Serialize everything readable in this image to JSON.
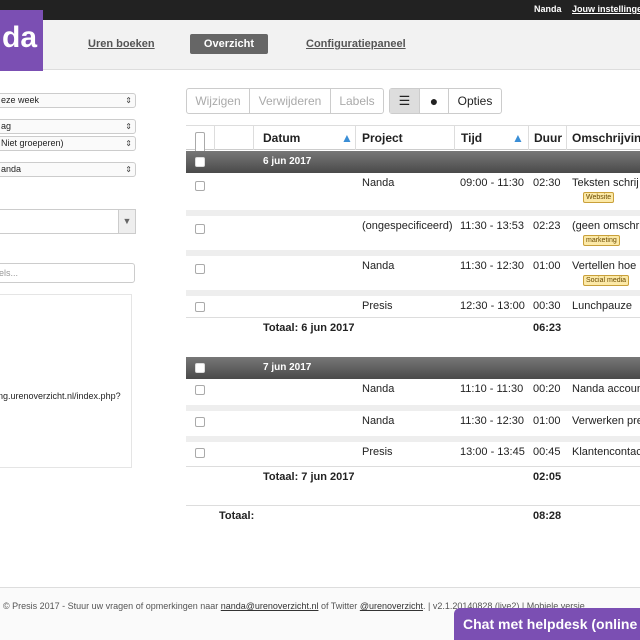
{
  "topbar": {
    "user": "Nanda",
    "settings_link": "Jouw instellinge"
  },
  "logo": {
    "text": "da"
  },
  "nav": {
    "tabs": [
      {
        "label": "Uren boeken"
      },
      {
        "label": "Overzicht"
      },
      {
        "label": "Configuratiepaneel"
      }
    ],
    "active": "Overzicht"
  },
  "filters": {
    "period": "eze week",
    "group1": "ag",
    "group2": "Niet groeperen)",
    "user": "anda",
    "label_placeholder": "els..."
  },
  "export_url": "ng.urenoverzicht.nl/index.php?",
  "toolbar": {
    "edit": "Wijzigen",
    "delete": "Verwijderen",
    "labels": "Labels",
    "options": "Opties"
  },
  "table": {
    "columns": [
      "Datum",
      "Project",
      "Tijd",
      "Duur",
      "Omschrijvin"
    ],
    "groups": [
      {
        "date": "6 jun 2017",
        "rows": [
          {
            "project": "Nanda",
            "time": "09:00 - 11:30",
            "duration": "02:30",
            "description": "Teksten schrij",
            "tag": "Website"
          },
          {
            "project": "(ongespecificeerd)",
            "time": "11:30 - 13:53",
            "duration": "02:23",
            "description": "(geen omschri",
            "tag": "marketing"
          },
          {
            "project": "Nanda",
            "time": "11:30 - 12:30",
            "duration": "01:00",
            "description": "Vertellen hoe l",
            "tag": "Social media"
          },
          {
            "project": "Presis",
            "time": "12:30 - 13:00",
            "duration": "00:30",
            "description": "Lunchpauze",
            "tag": ""
          }
        ],
        "total_label": "Totaal: 6 jun 2017",
        "total": "06:23"
      },
      {
        "date": "7 jun 2017",
        "rows": [
          {
            "project": "Nanda",
            "time": "11:10 - 11:30",
            "duration": "00:20",
            "description": "Nanda accoun",
            "tag": ""
          },
          {
            "project": "Nanda",
            "time": "11:30 - 12:30",
            "duration": "01:00",
            "description": "Verwerken pre",
            "tag": ""
          },
          {
            "project": "Presis",
            "time": "13:00 - 13:45",
            "duration": "00:45",
            "description": "Klantencontac",
            "tag": ""
          }
        ],
        "total_label": "Totaal: 7 jun 2017",
        "total": "02:05"
      }
    ],
    "grand_total_label": "Totaal:",
    "grand_total": "08:28"
  },
  "footer": {
    "copyright": "© Presis 2017 - Stuur uw vragen of opmerkingen naar ",
    "email": "nanda@urenoverzicht.nl",
    "mid": " of Twitter ",
    "twitter": "@urenoverzicht",
    "version": ".  |  v2.1.20140828 (live2)  |  Mobiele versie"
  },
  "chat": {
    "label": "Chat met helpdesk (online"
  },
  "colors": {
    "brand": "#7b4fb3",
    "header_dark": "#222222",
    "tag_bg": "#fce9a7"
  }
}
